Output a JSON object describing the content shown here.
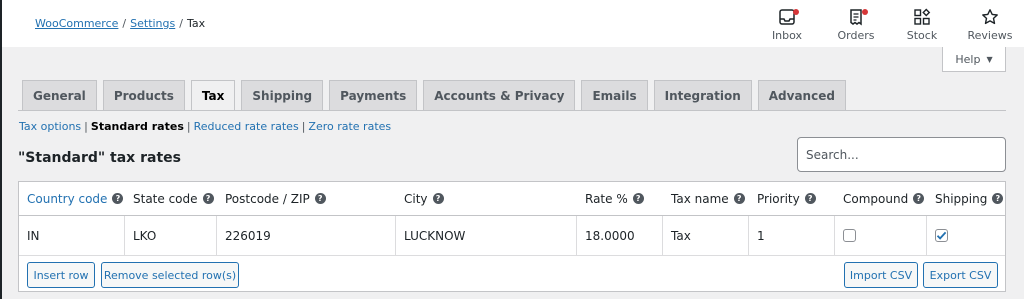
{
  "breadcrumb": {
    "root": "WooCommerce",
    "settings": "Settings",
    "current": "Tax",
    "separator": "/"
  },
  "activity": [
    {
      "label": "Inbox",
      "icon": "inbox-icon",
      "has_dot": true
    },
    {
      "label": "Orders",
      "icon": "orders-icon",
      "has_dot": true
    },
    {
      "label": "Stock",
      "icon": "stock-icon",
      "has_dot": false
    },
    {
      "label": "Reviews",
      "icon": "star-icon",
      "has_dot": false
    }
  ],
  "help": {
    "label": "Help",
    "arrow": "▼"
  },
  "tabs": [
    {
      "label": "General",
      "active": false
    },
    {
      "label": "Products",
      "active": false
    },
    {
      "label": "Tax",
      "active": true
    },
    {
      "label": "Shipping",
      "active": false
    },
    {
      "label": "Payments",
      "active": false
    },
    {
      "label": "Accounts & Privacy",
      "active": false
    },
    {
      "label": "Emails",
      "active": false
    },
    {
      "label": "Integration",
      "active": false
    },
    {
      "label": "Advanced",
      "active": false
    }
  ],
  "subsections": {
    "tax_options": "Tax options",
    "standard_rates": "Standard rates",
    "reduced_rates": "Reduced rate rates",
    "zero_rates": "Zero rate rates",
    "sep": "|"
  },
  "rates": {
    "title": "\"Standard\" tax rates",
    "search_placeholder": "Search..."
  },
  "table": {
    "headers": {
      "country": "Country code",
      "state": "State code",
      "postcode": "Postcode / ZIP",
      "city": "City",
      "rate": "Rate %",
      "name": "Tax name",
      "priority": "Priority",
      "compound": "Compound",
      "shipping": "Shipping"
    },
    "help_glyph": "?",
    "row": {
      "country": "IN",
      "state": "LKO",
      "postcode": "226019",
      "city": "LUCKNOW",
      "rate": "18.0000",
      "name": "Tax",
      "priority": "1",
      "compound": false,
      "shipping": true
    }
  },
  "buttons": {
    "insert": "Insert row",
    "remove": "Remove selected row(s)",
    "import": "Import CSV",
    "export": "Export CSV"
  },
  "colors": {
    "link": "#2271b1",
    "notification": "#d63638",
    "text": "#1d2327"
  }
}
